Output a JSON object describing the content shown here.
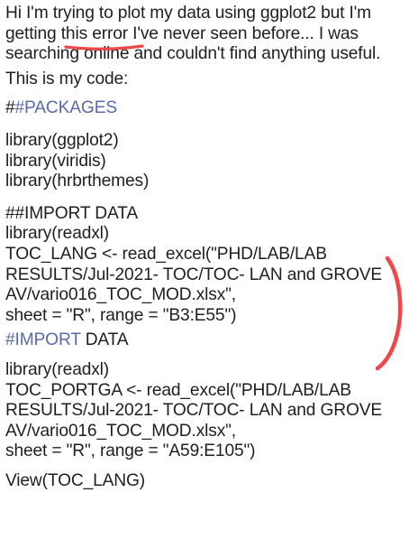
{
  "intro": {
    "line1": "Hi I'm trying to plot my data using ggplot2 but I'm",
    "line2_before": "getting ",
    "line2_highlight": "this error",
    "line2_after": " I've never seen before... I was",
    "line3": "searching online and couldn't find anything useful."
  },
  "code_label": "This is my code:",
  "packages_header": {
    "hash_plain": "#",
    "hash_link": "#PACKAGES"
  },
  "packages": [
    "library(ggplot2)",
    "library(viridis)",
    "library(hrbrthemes)"
  ],
  "import1": {
    "header": "##IMPORT DATA",
    "lines": [
      "library(readxl)",
      "TOC_LANG <- read_excel(\"PHD/LAB/LAB",
      "RESULTS/Jul-2021- TOC/TOC- LAN and GROVE",
      "AV/vario016_TOC_MOD.xlsx\",",
      "sheet = \"R\", range = \"B3:E55\")"
    ]
  },
  "import2": {
    "header_link": "#IMPORT",
    "header_rest": " DATA",
    "lines": [
      "library(readxl)",
      "TOC_PORTGA <- read_excel(\"PHD/LAB/LAB",
      "RESULTS/Jul-2021- TOC/TOC- LAN and GROVE",
      "AV/vario016_TOC_MOD.xlsx\",",
      "sheet = \"R\", range = \"A59:E105\")"
    ]
  },
  "view_line": "View(TOC_LANG)",
  "colors": {
    "text": "#1f1f1f",
    "hashtag": "#5b6aa8",
    "annotation": "#f0484a"
  }
}
